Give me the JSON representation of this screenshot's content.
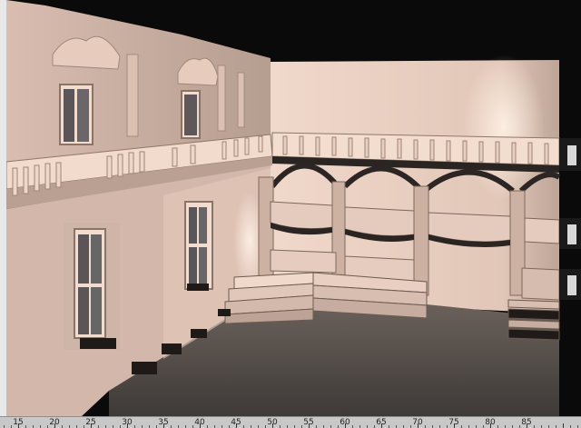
{
  "viewport": {
    "render": "3d-courtyard-render"
  },
  "timeline": {
    "labels": [
      "15",
      "20",
      "25",
      "30",
      "35",
      "40",
      "45",
      "50",
      "55",
      "60",
      "65",
      "70",
      "75",
      "80",
      "85"
    ],
    "start": 12.5,
    "end": 92.5
  },
  "colors": {
    "wall_light": "#e9cdbf",
    "wall_mid": "#cbb1a4",
    "wall_shadow": "#8e7a70",
    "floor": "#4f4a46",
    "sky": "#000000",
    "ruler_bg": "#c8c8c8"
  }
}
